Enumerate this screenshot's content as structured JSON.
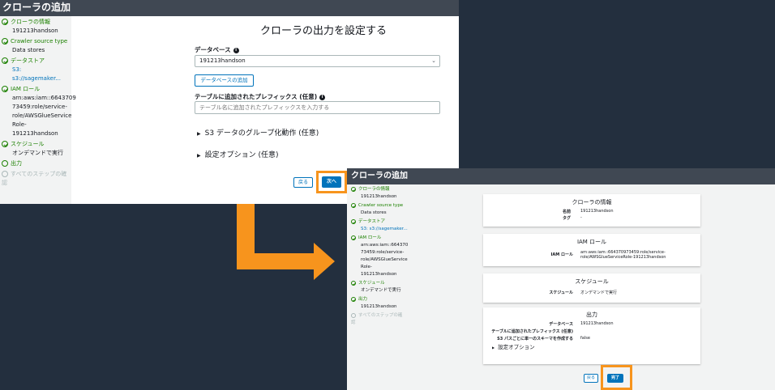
{
  "screen1": {
    "window_title": "クローラの追加",
    "sidebar": [
      {
        "label": "クローラの情報",
        "sub": "191213handson",
        "state": "done"
      },
      {
        "label": "Crawler source type",
        "sub": "Data stores",
        "state": "done"
      },
      {
        "label": "データストア",
        "sub": "S3: s3://sagemaker...",
        "state": "done"
      },
      {
        "label": "IAM ロール",
        "sub_lines": [
          "arn:aws:iam::6643709",
          "73459:role/service-",
          "role/AWSGlueService",
          "Role-191213handson"
        ],
        "state": "done"
      },
      {
        "label": "スケジュール",
        "sub": "オンデマンドで実行",
        "state": "done"
      },
      {
        "label": "出力",
        "state": "current"
      },
      {
        "label": "すべてのステップの確",
        "label2": "認",
        "state": "pending"
      }
    ],
    "heading": "クローラの出力を設定する",
    "database_label": "データベース",
    "database_value": "191213handson",
    "add_database_button": "データベースの追加",
    "prefix_label": "テーブルに追加されたプレフィックス (任意)",
    "prefix_placeholder": "テーブル名に追加されたプレフィックスを入力する",
    "grouping_label": "S3 データのグループ化動作 (任意)",
    "options_label": "設定オプション (任意)",
    "back_button": "戻る",
    "next_button": "次へ"
  },
  "screen2": {
    "window_title": "クローラの追加",
    "sidebar": [
      {
        "label": "クローラの情報",
        "sub": "191213handson",
        "state": "done"
      },
      {
        "label": "Crawler source type",
        "sub": "Data stores",
        "state": "done"
      },
      {
        "label": "データストア",
        "sub": "S3: s3://sagemaker...",
        "state": "done"
      },
      {
        "label": "IAM ロール",
        "sub_lines": [
          "arn:aws:iam::6643709",
          "73459:role/service-",
          "role/AWSGlueService",
          "Role-191213handson"
        ],
        "state": "done"
      },
      {
        "label": "スケジュール",
        "sub": "オンデマンドで実行",
        "state": "done"
      },
      {
        "label": "出力",
        "sub": "191213handson",
        "state": "done"
      },
      {
        "label": "すべてのステップの確",
        "label2": "認",
        "state": "pending"
      }
    ],
    "cards": {
      "info": {
        "title": "クローラの情報",
        "rows": [
          {
            "k": "名前",
            "v": "191213handson"
          },
          {
            "k": "タグ",
            "v": "-"
          }
        ]
      },
      "iam": {
        "title": "IAM ロール",
        "k": "IAM ロール",
        "v1": "arn:aws:iam::664370973459:role/service-",
        "v2": "role/AWSGlueServiceRole-191213handson"
      },
      "schedule": {
        "title": "スケジュール",
        "k": "スケジュール",
        "v": "オンデマンドで実行"
      },
      "output": {
        "title": "出力",
        "rows": [
          {
            "k": "データベース",
            "v": "191213handson"
          },
          {
            "k": "テーブルに追加されたプレフィックス (任意)",
            "v": ""
          },
          {
            "k": "S3 パスごとに単一のスキーマを作成する",
            "v": "false"
          }
        ],
        "options": "設定オプション"
      }
    },
    "back_button": "戻る",
    "finish_button": "完了"
  },
  "colors": {
    "highlight": "#f7941d",
    "primary": "#0073bb",
    "success": "#1d8102",
    "titlebar": "#404853",
    "background": "#232f3e"
  }
}
